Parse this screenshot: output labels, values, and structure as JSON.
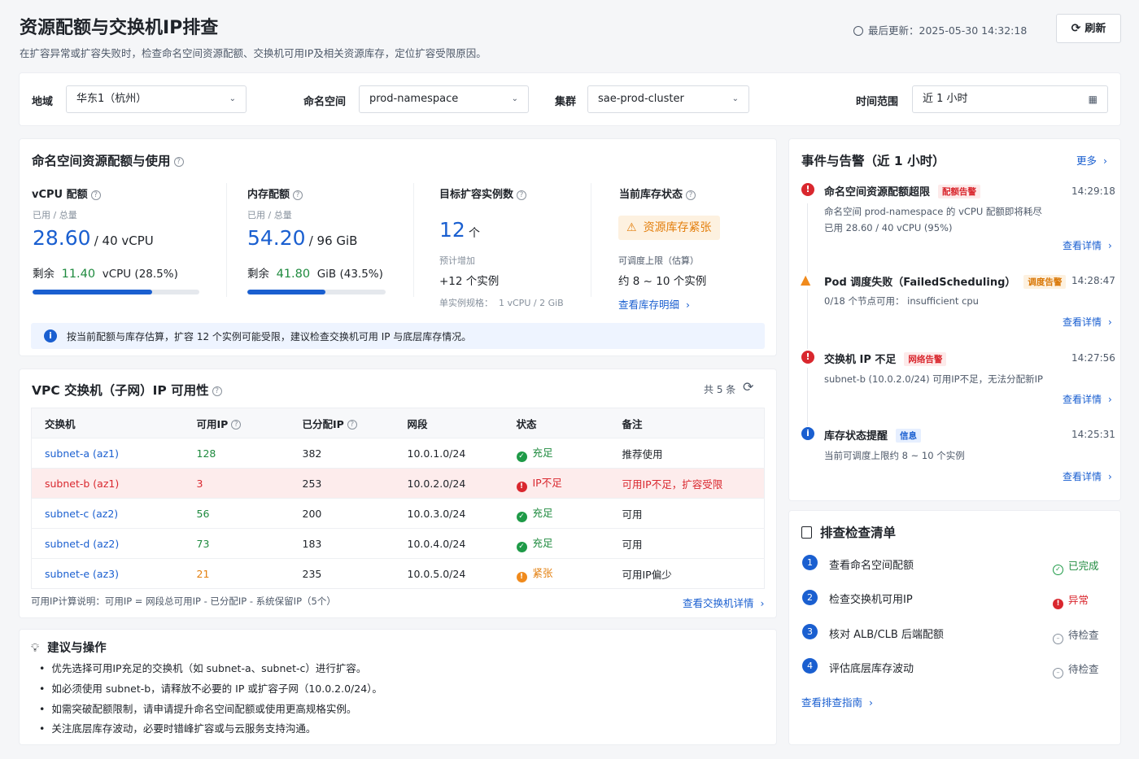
{
  "header": {
    "title": "资源配额与交换机IP排查",
    "subtitle": "在扩容异常或扩容失败时，检查命名空间资源配额、交换机可用IP及相关资源库存，定位扩容受限原因。",
    "last_updated_label": "最后更新：",
    "last_updated_value": "2025-05-30 14:32:18",
    "refresh_label": "刷新"
  },
  "filters": {
    "region_label": "地域",
    "region_value": "华东1（杭州）",
    "namespace_label": "命名空间",
    "namespace_value": "prod-namespace",
    "cluster_label": "集群",
    "cluster_value": "sae-prod-cluster",
    "time_label": "时间范围",
    "time_value": "近 1 小时"
  },
  "quota": {
    "title": "命名空间资源配额与使用",
    "vcpu": {
      "label": "vCPU 配额",
      "sub": "已用 / 总量",
      "used": "28.60",
      "total": "/ 40 vCPU",
      "remain_label": "剩余",
      "remain_value": "11.40",
      "remain_unit": "vCPU (28.5%)",
      "used_fraction": 0.715
    },
    "memory": {
      "label": "内存配额",
      "sub": "已用 / 总量",
      "used": "54.20",
      "total": "/ 96 GiB",
      "remain_label": "剩余",
      "remain_value": "41.80",
      "remain_unit": "GiB (43.5%)",
      "used_fraction": 0.565
    },
    "target": {
      "label": "目标扩容实例数",
      "value": "12",
      "unit": "个",
      "sub": "预计增加",
      "increase": "+12 个实例",
      "spec_label": "单实例规格：",
      "spec_value": "1 vCPU / 2 GiB"
    },
    "inventory": {
      "label": "当前库存状态",
      "status": "资源库存紧张",
      "sub": "可调度上限（估算）",
      "estimate": "约 8 ~ 10 个实例",
      "link": "查看库存明细"
    },
    "notice": "按当前配额与库存估算，扩容 12 个实例可能受限，建议检查交换机可用 IP 与底层库存情况。"
  },
  "vswitch": {
    "title": "VPC 交换机（子网）IP 可用性",
    "count": "共 5 条",
    "columns": [
      "交换机",
      "可用IP",
      "已分配IP",
      "网段",
      "状态",
      "备注"
    ],
    "rows": [
      {
        "name": "subnet-a (az1)",
        "avail": "128",
        "alloc": "382",
        "cidr": "10.0.1.0/24",
        "status": "充足",
        "note": "推荐使用"
      },
      {
        "name": "subnet-b (az1)",
        "avail": "3",
        "alloc": "253",
        "cidr": "10.0.2.0/24",
        "status": "IP不足",
        "note": "可用IP不足，扩容受限"
      },
      {
        "name": "subnet-c (az2)",
        "avail": "56",
        "alloc": "200",
        "cidr": "10.0.3.0/24",
        "status": "充足",
        "note": "可用"
      },
      {
        "name": "subnet-d (az2)",
        "avail": "73",
        "alloc": "183",
        "cidr": "10.0.4.0/24",
        "status": "充足",
        "note": "可用"
      },
      {
        "name": "subnet-e (az3)",
        "avail": "21",
        "alloc": "235",
        "cidr": "10.0.5.0/24",
        "status": "紧张",
        "note": "可用IP偏少"
      }
    ],
    "footnote": "可用IP计算说明：可用IP = 网段总可用IP - 已分配IP - 系统保留IP（5个）",
    "detail_link": "查看交换机详情"
  },
  "suggestions": {
    "title": "建议与操作",
    "items": [
      "优先选择可用IP充足的交换机（如 subnet-a、subnet-c）进行扩容。",
      "如必须使用 subnet-b，请释放不必要的 IP 或扩容子网（10.0.2.0/24）。",
      "如需突破配额限制，请申请提升命名空间配额或使用更高规格实例。",
      "关注底层库存波动，必要时错峰扩容或与云服务支持沟通。"
    ]
  },
  "events": {
    "title": "事件与告警（近 1 小时）",
    "more": "更多",
    "items": [
      {
        "title": "命名空间资源配额超限",
        "tag": "配额告警",
        "time": "14:29:18",
        "desc1": "命名空间 prod-namespace 的 vCPU 配额即将耗尽",
        "desc2": "已用 28.60 / 40 vCPU (95%)",
        "link": "查看详情"
      },
      {
        "title": "Pod 调度失败（FailedScheduling）",
        "tag": "调度告警",
        "time": "14:28:47",
        "desc1": "0/18 个节点可用： insufficient cpu",
        "link": "查看详情"
      },
      {
        "title": "交换机 IP 不足",
        "tag": "网络告警",
        "time": "14:27:56",
        "desc1": "subnet-b (10.0.2.0/24) 可用IP不足，无法分配新IP",
        "link": "查看详情"
      },
      {
        "title": "库存状态提醒",
        "tag": "信息",
        "time": "14:25:31",
        "desc1": "当前可调度上限约 8 ~ 10 个实例",
        "link": "查看详情"
      }
    ]
  },
  "checklist": {
    "title": "排查检查清单",
    "items": [
      {
        "num": "1",
        "label": "查看命名空间配额",
        "status": "已完成"
      },
      {
        "num": "2",
        "label": "检查交换机可用IP",
        "status": "异常"
      },
      {
        "num": "3",
        "label": "核对 ALB/CLB 后端配额",
        "status": "待检查"
      },
      {
        "num": "4",
        "label": "评估底层库存波动",
        "status": "待检查"
      }
    ],
    "guide_link": "查看排查指南"
  },
  "colors": {
    "accent": "#1a5fd0",
    "danger": "#d9272e",
    "warning": "#e37f0e",
    "success": "#1e8a3e"
  }
}
